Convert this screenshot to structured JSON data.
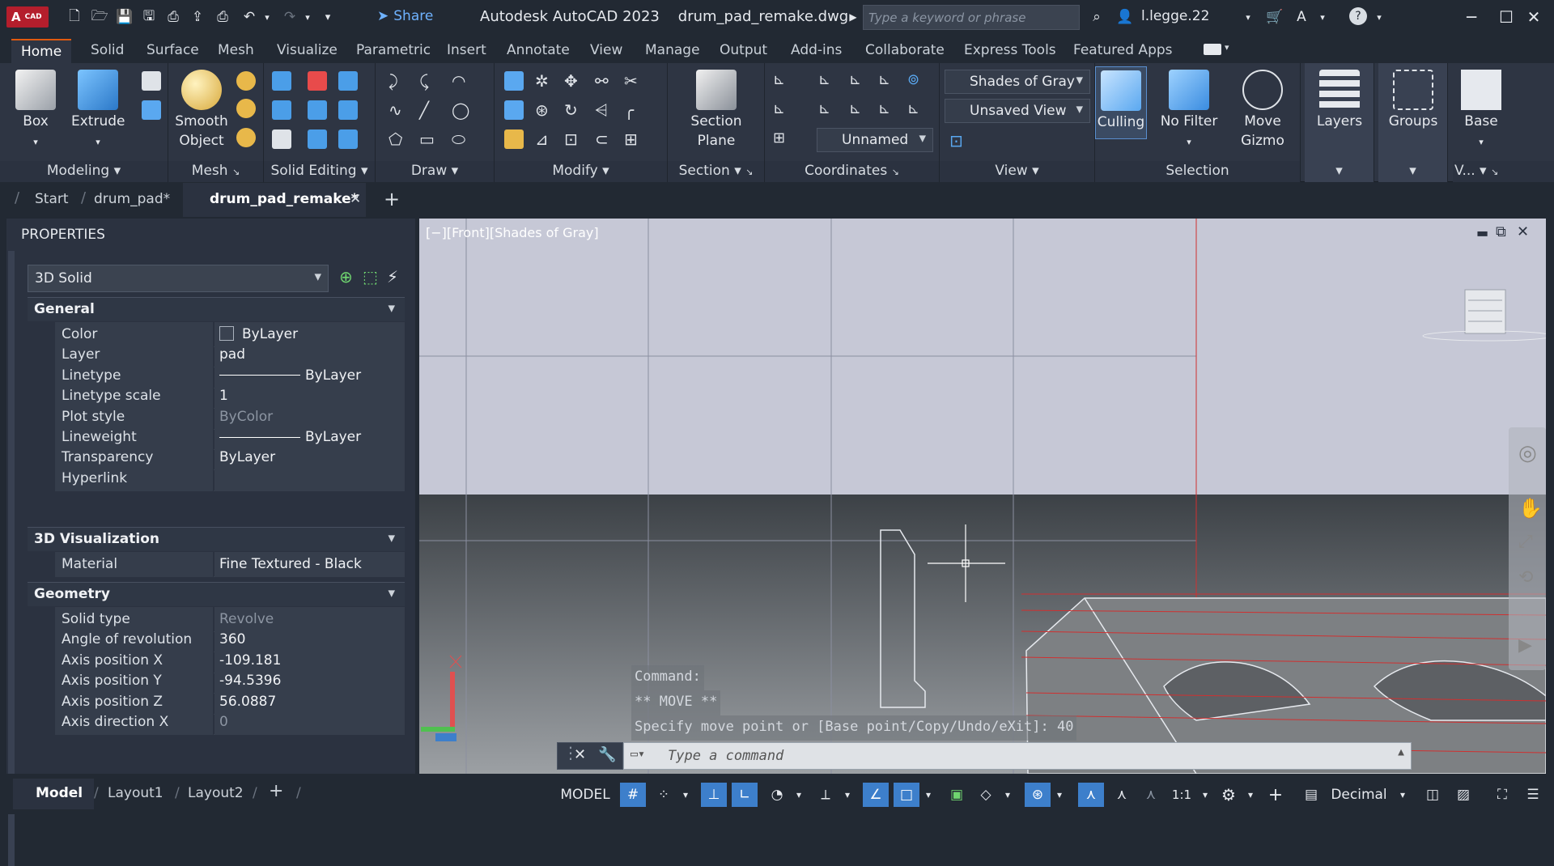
{
  "title_bar": {
    "logo_a": "A",
    "logo_cad": "CAD",
    "share": "Share",
    "app_title": "Autodesk AutoCAD 2023    drum_pad_remake.dwg",
    "search_placeholder": "Type a keyword or phrase",
    "user": "l.legge.22"
  },
  "ribbon_tabs": [
    "Home",
    "Solid",
    "Surface",
    "Mesh",
    "Visualize",
    "Parametric",
    "Insert",
    "Annotate",
    "View",
    "Manage",
    "Output",
    "Add-ins",
    "Collaborate",
    "Express Tools",
    "Featured Apps"
  ],
  "ribbon": {
    "box": "Box",
    "extrude": "Extrude",
    "smooth_object_1": "Smooth",
    "smooth_object_2": "Object",
    "section_plane_1": "Section",
    "section_plane_2": "Plane",
    "visual_style": "Shades of Gray",
    "saved_view": "Unsaved View",
    "ucs": "Unnamed",
    "culling": "Culling",
    "no_filter": "No Filter",
    "move_gizmo_1": "Move",
    "move_gizmo_2": "Gizmo",
    "layers": "Layers",
    "groups": "Groups",
    "base": "Base",
    "panels": {
      "modeling": "Modeling",
      "mesh": "Mesh",
      "solid_editing": "Solid Editing",
      "draw": "Draw",
      "modify": "Modify",
      "section": "Section",
      "coordinates": "Coordinates",
      "view": "View",
      "selection": "Selection",
      "v": "V..."
    }
  },
  "doc_tabs": [
    "Start",
    "drum_pad*",
    "drum_pad_remake*"
  ],
  "properties": {
    "header": "PROPERTIES",
    "object_type": "3D Solid",
    "sections": {
      "general": "General",
      "visualization": "3D Visualization",
      "geometry": "Geometry"
    },
    "general": [
      {
        "label": "Color",
        "value": "ByLayer"
      },
      {
        "label": "Layer",
        "value": "pad"
      },
      {
        "label": "Linetype",
        "value": "ByLayer"
      },
      {
        "label": "Linetype scale",
        "value": "1"
      },
      {
        "label": "Plot style",
        "value": "ByColor"
      },
      {
        "label": "Lineweight",
        "value": "ByLayer"
      },
      {
        "label": "Transparency",
        "value": "ByLayer"
      },
      {
        "label": "Hyperlink",
        "value": ""
      }
    ],
    "visualization": [
      {
        "label": "Material",
        "value": "Fine Textured - Black"
      }
    ],
    "geometry": [
      {
        "label": "Solid type",
        "value": "Revolve"
      },
      {
        "label": "Angle of revolution",
        "value": "360"
      },
      {
        "label": "Axis position X",
        "value": "-109.181"
      },
      {
        "label": "Axis position Y",
        "value": "-94.5396"
      },
      {
        "label": "Axis position Z",
        "value": "56.0887"
      },
      {
        "label": "Axis direction X",
        "value": "0"
      }
    ]
  },
  "viewport": {
    "label": "[−][Front][Shades of Gray]"
  },
  "command": {
    "history": [
      "Command:",
      "** MOVE **",
      "Specify move point or [Base point/Copy/Undo/eXit]: 40"
    ],
    "placeholder": "Type a command"
  },
  "status": {
    "layouts": [
      "Model",
      "Layout1",
      "Layout2"
    ],
    "model": "MODEL",
    "scale": "1:1",
    "units": "Decimal"
  },
  "colors": {
    "accent": "#3d7fcb",
    "app_red": "#b41e2c",
    "background": "#222933"
  }
}
